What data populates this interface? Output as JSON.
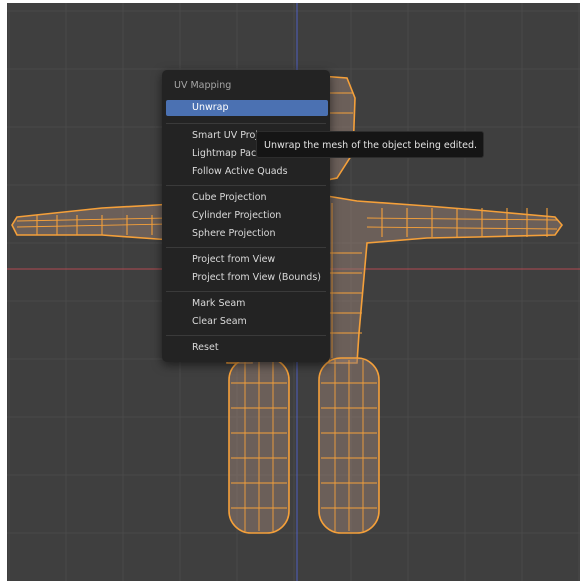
{
  "menu": {
    "title": "UV Mapping",
    "items": [
      {
        "label": "Unwrap"
      },
      {
        "label": "Smart UV Proje"
      },
      {
        "label": "Lightmap Pack"
      },
      {
        "label": "Follow Active Quads"
      },
      {
        "label": "Cube Projection"
      },
      {
        "label": "Cylinder Projection"
      },
      {
        "label": "Sphere Projection"
      },
      {
        "label": "Project from View"
      },
      {
        "label": "Project from View (Bounds)"
      },
      {
        "label": "Mark Seam"
      },
      {
        "label": "Clear Seam"
      },
      {
        "label": "Reset"
      }
    ]
  },
  "tooltip": {
    "text": "Unwrap the mesh of the object being edited."
  },
  "colors": {
    "viewport_bg": "#3f3f3f",
    "mesh_wire": "#f5a03a",
    "mesh_fill": "#8f7a70",
    "x_axis": "#b24a50",
    "z_axis": "#4f5fbf",
    "menu_highlight": "#4b71b2"
  },
  "icons": [
    "mesh-model"
  ]
}
